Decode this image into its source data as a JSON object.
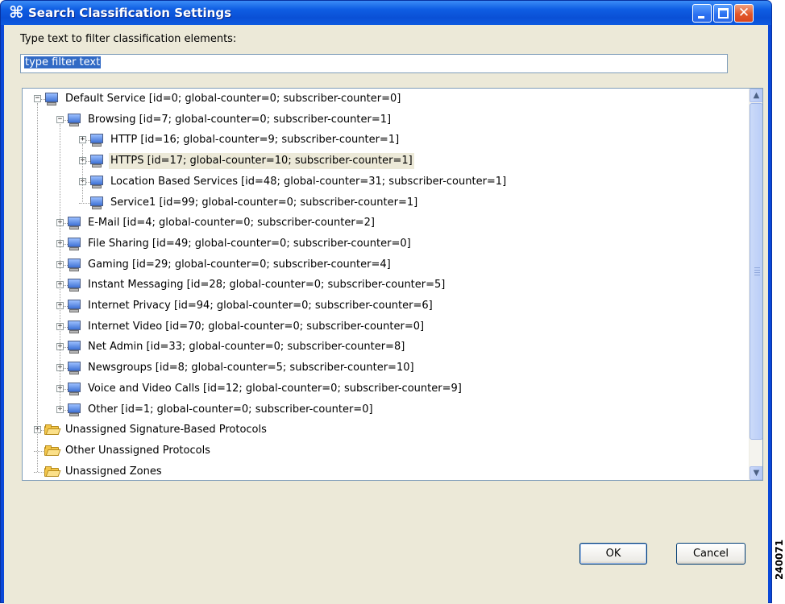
{
  "window": {
    "title": "Search Classification Settings",
    "app_icon": "⌘"
  },
  "filter": {
    "label": "Type text to filter classification elements:",
    "value": "type filter text"
  },
  "tree": {
    "nodes": [
      {
        "label": "Default Service [id=0; global-counter=0; subscriber-counter=0]",
        "icon": "monitor-icon",
        "expander": "−"
      },
      {
        "label": "Browsing [id=7; global-counter=0; subscriber-counter=1]",
        "icon": "monitor-icon",
        "expander": "−"
      },
      {
        "label": "HTTP [id=16; global-counter=9; subscriber-counter=1]",
        "icon": "monitor-icon",
        "expander": "+"
      },
      {
        "label": "HTTPS [id=17; global-counter=10; subscriber-counter=1]",
        "icon": "monitor-icon",
        "expander": "+"
      },
      {
        "label": "Location Based Services [id=48; global-counter=31; subscriber-counter=1]",
        "icon": "monitor-icon",
        "expander": "+"
      },
      {
        "label": "Service1 [id=99; global-counter=0; subscriber-counter=1]",
        "icon": "monitor-icon",
        "expander": ""
      },
      {
        "label": "E-Mail [id=4; global-counter=0; subscriber-counter=2]",
        "icon": "monitor-icon",
        "expander": "+"
      },
      {
        "label": "File Sharing [id=49; global-counter=0; subscriber-counter=0]",
        "icon": "monitor-icon",
        "expander": "+"
      },
      {
        "label": "Gaming [id=29; global-counter=0; subscriber-counter=4]",
        "icon": "monitor-icon",
        "expander": "+"
      },
      {
        "label": "Instant Messaging [id=28; global-counter=0; subscriber-counter=5]",
        "icon": "monitor-icon",
        "expander": "+"
      },
      {
        "label": "Internet Privacy [id=94; global-counter=0; subscriber-counter=6]",
        "icon": "monitor-icon",
        "expander": "+"
      },
      {
        "label": "Internet Video [id=70; global-counter=0; subscriber-counter=0]",
        "icon": "monitor-icon",
        "expander": "+"
      },
      {
        "label": "Net Admin [id=33; global-counter=0; subscriber-counter=8]",
        "icon": "monitor-icon",
        "expander": "+"
      },
      {
        "label": "Newsgroups [id=8; global-counter=5; subscriber-counter=10]",
        "icon": "monitor-icon",
        "expander": "+"
      },
      {
        "label": "Voice and Video Calls [id=12; global-counter=0; subscriber-counter=9]",
        "icon": "monitor-icon",
        "expander": "+"
      },
      {
        "label": "Other [id=1; global-counter=0; subscriber-counter=0]",
        "icon": "monitor-icon",
        "expander": "+"
      },
      {
        "label": "Unassigned Signature-Based Protocols",
        "icon": "folder-icon",
        "expander": "+"
      },
      {
        "label": "Other Unassigned Protocols",
        "icon": "folder-icon",
        "expander": ""
      },
      {
        "label": "Unassigned Zones",
        "icon": "folder-icon",
        "expander": ""
      }
    ]
  },
  "buttons": {
    "ok": "OK",
    "cancel": "Cancel"
  },
  "side_figure_number": "240071",
  "colors": {
    "title_bar": "#0a50d6",
    "dialog_bg": "#ece9d8",
    "selection": "#316ac5"
  }
}
